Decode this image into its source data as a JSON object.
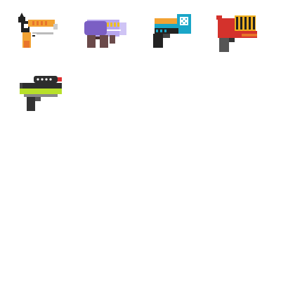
{
  "sprite_sheet": {
    "sprites": [
      {
        "icon": "orange-blaster-icon",
        "colors": {
          "body": "#f2a233",
          "top": "#ffffff",
          "dark": "#222222",
          "accent": "#e8742a"
        }
      },
      {
        "icon": "purple-blaster-icon",
        "colors": {
          "body": "#7b5fc4",
          "barrel": "#b7a6ee",
          "grip": "#6b4a4a",
          "accent": "#f0c020"
        }
      },
      {
        "icon": "teal-blaster-icon",
        "colors": {
          "body": "#1aa6c8",
          "top": "#f2a233",
          "grip": "#222222",
          "accent": "#ffffff"
        }
      },
      {
        "icon": "red-blaster-icon",
        "colors": {
          "body": "#d4322c",
          "drum": "#f0b020",
          "grip": "#555555",
          "accent": "#e8742a"
        }
      },
      {
        "icon": "lime-blaster-icon",
        "colors": {
          "body": "#2d2d2d",
          "stripe": "#b8e02a",
          "grip": "#333333",
          "accent": "#e03030"
        }
      }
    ]
  }
}
